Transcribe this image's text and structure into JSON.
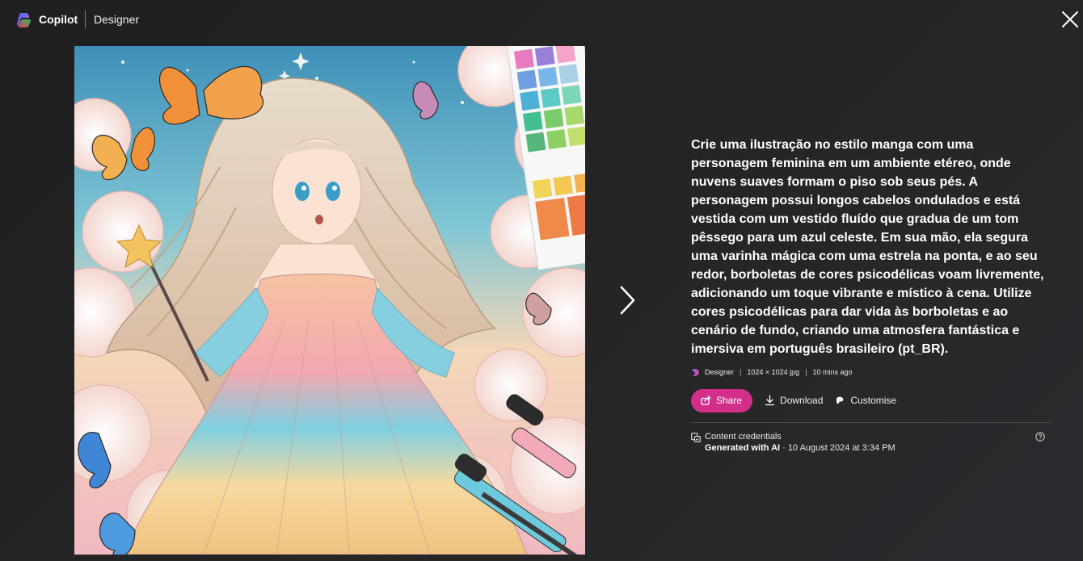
{
  "header": {
    "app_name": "Copilot",
    "section": "Designer"
  },
  "image": {
    "description_icon": "generated-artwork"
  },
  "panel": {
    "prompt": "Crie uma ilustração no estilo manga com uma personagem feminina em um ambiente etéreo, onde nuvens suaves formam o piso sob seus pés. A personagem possui longos cabelos ondulados e está vestida com um vestido fluído que gradua de um tom pêssego para um azul celeste. Em sua mão, ela segura uma varinha mágica com uma estrela na ponta, e ao seu redor, borboletas de cores psicodélicas voam livremente, adicionando um toque vibrante e místico à cena. Utilize cores psicodélicas para dar vida às borboletas e ao cenário de fundo, criando uma atmosfera fantástica e imersiva em português brasileiro (pt_BR).",
    "meta": {
      "source": "Designer",
      "size": "1024 × 1024 jpg",
      "time": "10 mins ago"
    },
    "actions": {
      "share": "Share",
      "download": "Download",
      "customise": "Customise"
    },
    "credentials": {
      "title": "Content credentials",
      "generated": "Generated with AI",
      "separator": "·",
      "date": "10 August 2024 at 3:34 PM"
    }
  },
  "colors": {
    "share_button": "#d12f8a",
    "background": "#1c1c1c"
  }
}
